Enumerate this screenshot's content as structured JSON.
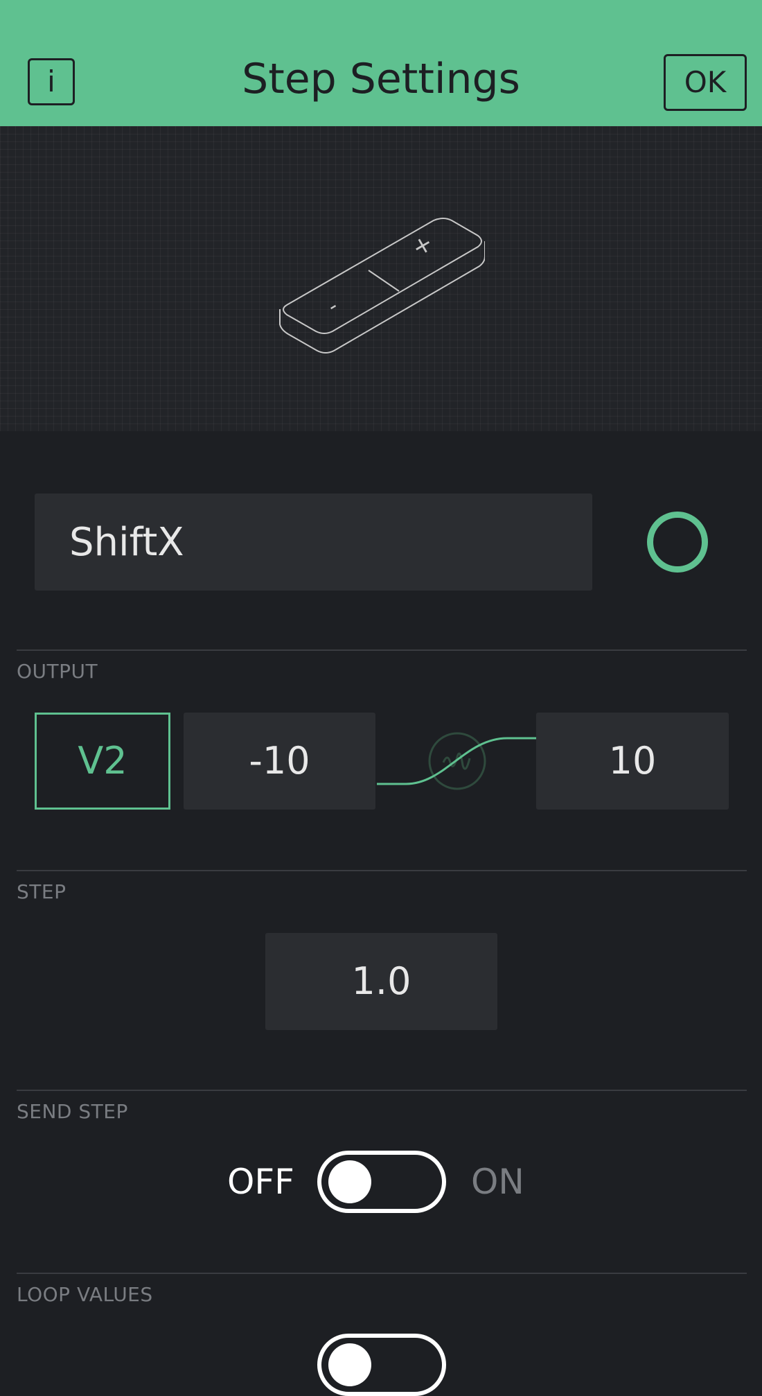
{
  "header": {
    "title": "Step Settings",
    "info_label": "i",
    "ok_label": "OK",
    "bg_color": "#5fc190"
  },
  "preview": {
    "widget_icon": "step-widget-icon",
    "minus_glyph": "-",
    "plus_glyph": "+"
  },
  "name": {
    "value": "ShiftX",
    "color_icon": "color-ring-icon",
    "accent_color": "#5fc190"
  },
  "output": {
    "section_label": "OUTPUT",
    "pin": "V2",
    "min": "-10",
    "max": "10",
    "mapping_icon": "curve-icon"
  },
  "step": {
    "section_label": "STEP",
    "value": "1.0"
  },
  "send_step": {
    "section_label": "SEND STEP",
    "off_label": "OFF",
    "on_label": "ON",
    "state": "off"
  },
  "loop_values": {
    "section_label": "LOOP VALUES"
  }
}
